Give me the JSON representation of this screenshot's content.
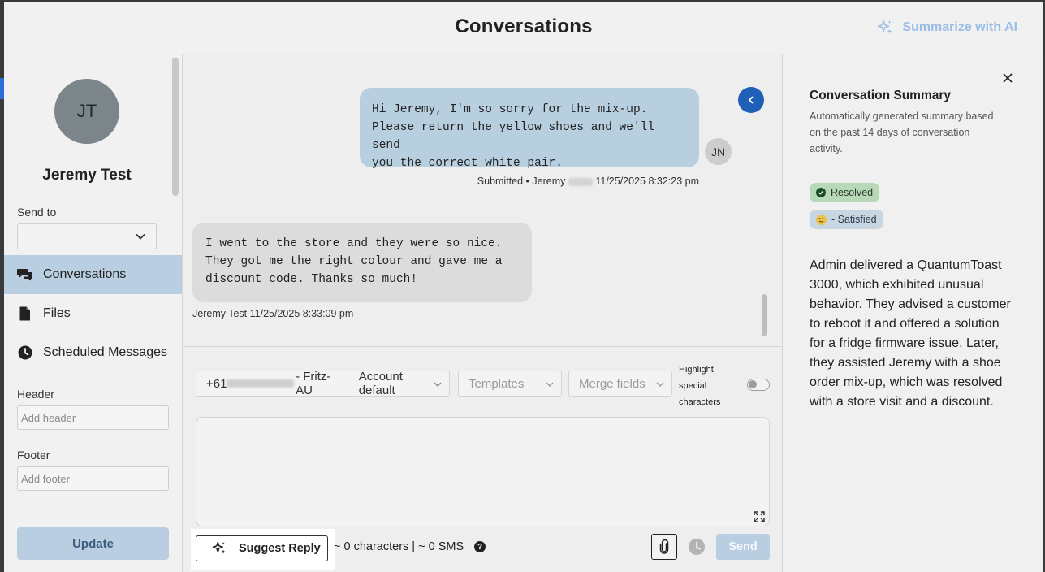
{
  "header": {
    "title": "Conversations",
    "ai_button": "Summarize with AI"
  },
  "contact": {
    "initials": "JT",
    "name": "Jeremy Test",
    "send_to_label": "Send to",
    "send_to_value": ""
  },
  "nav": {
    "items": [
      {
        "label": "Conversations",
        "icon": "chat-bubbles-icon",
        "active": true
      },
      {
        "label": "Files",
        "icon": "file-icon",
        "active": false
      },
      {
        "label": "Scheduled Messages",
        "icon": "clock-icon",
        "active": false
      }
    ]
  },
  "form": {
    "header_label": "Header",
    "header_placeholder": "Add header",
    "footer_label": "Footer",
    "footer_placeholder": "Add footer",
    "update_label": "Update"
  },
  "messages": [
    {
      "direction": "outgoing",
      "lines": [
        "Hi Jeremy, I'm so sorry for the mix-up.",
        "Please return the yellow shoes and we'll send",
        "you the correct white pair."
      ],
      "avatar": "JN",
      "meta_prefix": "Submitted • Jeremy",
      "meta_time": "11/25/2025 8:32:23 pm"
    },
    {
      "direction": "incoming",
      "lines": [
        "I went to the store and they were so nice.",
        "They got me the right colour and gave me a",
        "discount code. Thanks so much!"
      ],
      "meta_prefix": "Jeremy Test",
      "meta_time": "11/25/2025 8:33:09 pm"
    }
  ],
  "compose": {
    "phone_prefix": "+61",
    "phone_suffix": "- Fritz-AU",
    "account": "Account default",
    "templates": "Templates",
    "merge_fields": "Merge fields",
    "highlight_label": "Highlight special characters",
    "highlight_on": false,
    "message_value": "",
    "suggest_reply": "Suggest Reply",
    "counts": "~ 0 characters | ~ 0 SMS",
    "help": "?",
    "send": "Send"
  },
  "summary": {
    "title": "Conversation Summary",
    "subtitle": "Automatically generated summary based on the past 14 days of conversation activity.",
    "status": "Resolved",
    "sentiment": "- Satisfied",
    "text": "Admin delivered a QuantumToast 3000, which exhibited unusual behavior. They advised a customer to reboot it and offered a solution for a fridge firmware issue. Later, they assisted Jeremy with a shoe order mix-up, which was resolved with a store visit and a discount."
  },
  "colors": {
    "accent": "#1f5fb8",
    "active_nav": "#b9cee0",
    "outgoing_bubble": "#b8cfe0",
    "incoming_bubble": "#dcdcdc",
    "resolved_badge": "#b8d9b8"
  }
}
